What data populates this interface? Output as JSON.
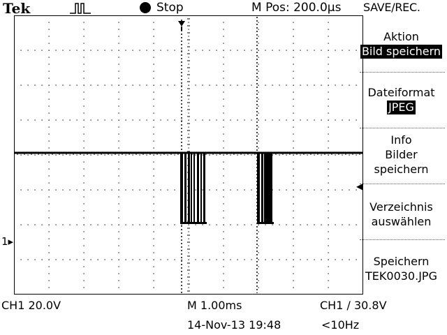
{
  "header": {
    "brand": "Tek",
    "trigger_icon": "pulse-trigger-icon",
    "run_status": "Stop",
    "m_pos": "M Pos: 200.0µs",
    "menu_title": "SAVE/REC."
  },
  "menu": {
    "items": [
      {
        "label": "Aktion",
        "value": "Bild speichern",
        "highlight": true
      },
      {
        "label": "Dateiformat",
        "value": "JPEG",
        "highlight": true
      },
      {
        "line1": "Info",
        "line2": "Bilder",
        "line3": "speichern"
      },
      {
        "line1": "Verzeichnis",
        "line2": "auswählen"
      },
      {
        "line1": "Speichern",
        "line2": "TEK0030.JPG"
      }
    ]
  },
  "status": {
    "ch1_scale": "CH1  20.0V",
    "timebase": "M 1.00ms",
    "trigger_info": "CH1 ∕ 30.8V",
    "datetime": "14-Nov-13 19:48",
    "trigger_freq": "<10Hz"
  },
  "markers": {
    "ch1": "1▸",
    "trigger_level": "◀"
  },
  "colors": {
    "background": "#ffffff",
    "trace": "#000000",
    "grid": "#000000"
  }
}
